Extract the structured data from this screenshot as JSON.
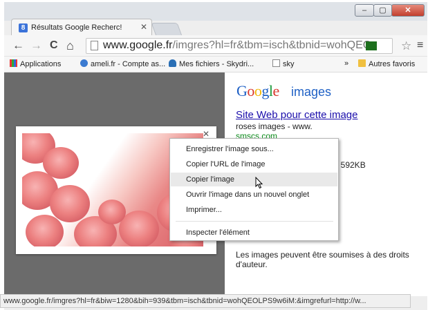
{
  "tab": {
    "title": "Résultats Google Recherc!",
    "favicon": "8"
  },
  "window": {
    "min_label": "–",
    "max_label": "▢",
    "close_label": "✕"
  },
  "toolbar": {
    "back_icon": "←",
    "forward_icon": "→",
    "reload_icon": "C",
    "home_icon": "⌂",
    "url_host": "www.google.fr",
    "url_path": "/imgres?hl=fr&tbm=isch&tbnid=wohQEC",
    "star_icon": "☆",
    "menu_icon": "≡"
  },
  "bookmarks": {
    "apps": "Applications",
    "ameli": "ameli.fr - Compte as...",
    "skydrive": "Mes fichiers - Skydri...",
    "sky": "sky",
    "more": "»",
    "others": "Autres favoris"
  },
  "result": {
    "logo": [
      "G",
      "o",
      "o",
      "g",
      "l",
      "e"
    ],
    "logo_colors": [
      "#1e60c5",
      "#d9362b",
      "#f2b705",
      "#1e60c5",
      "#1b9a3c",
      "#d9362b"
    ],
    "images_label": "images",
    "site_link": "Site Web pour cette image",
    "description": "roses images - www.",
    "domain": "smscs.com",
    "size": "), 592KB",
    "rights": "Les images peuvent être soumises à des droits d'auteur."
  },
  "preview": {
    "close_label": "✕"
  },
  "context_menu": {
    "items": [
      "Enregistrer l'image sous...",
      "Copier l'URL de l'image",
      "Copier l'image",
      "Ouvrir l'image dans un nouvel onglet",
      "Imprimer...",
      "Inspecter l'élément"
    ],
    "highlighted_index": 2
  },
  "status": {
    "text": "www.google.fr/imgres?hl=fr&biw=1280&bih=939&tbm=isch&tbnid=wohQEOLPS9w6iM:&imgrefurl=http://w..."
  }
}
